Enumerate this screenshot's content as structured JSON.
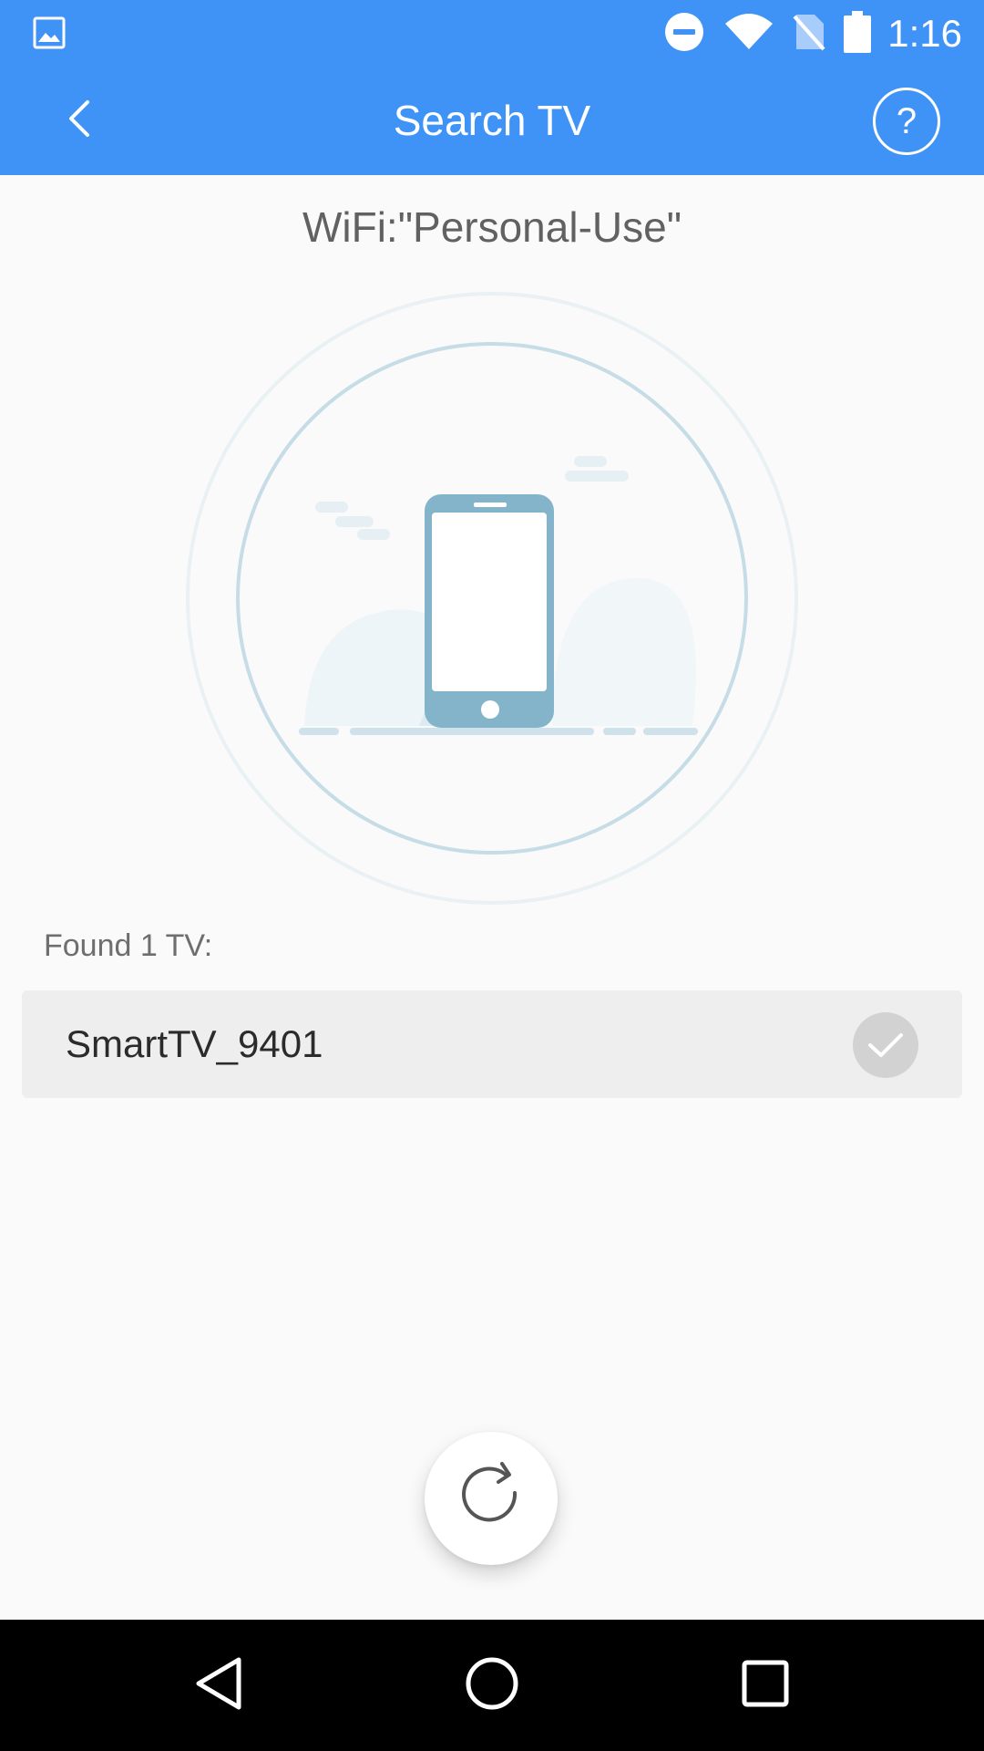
{
  "status_bar": {
    "time": "1:16",
    "icons": [
      "gallery-icon",
      "do-not-disturb-icon",
      "wifi-icon",
      "no-sim-icon",
      "battery-icon"
    ]
  },
  "app_bar": {
    "title": "Search TV",
    "back_icon": "chevron-left-icon",
    "help_label": "?"
  },
  "wifi": {
    "label": "WiFi:\"Personal-Use\""
  },
  "results": {
    "found_label": "Found 1 TV:",
    "devices": [
      {
        "name": "SmartTV_9401",
        "selected_icon": "check-icon"
      }
    ]
  },
  "refresh": {
    "icon": "refresh-icon"
  },
  "nav_bar": {
    "icons": [
      "back-triangle-icon",
      "home-circle-icon",
      "recents-square-icon"
    ]
  },
  "colors": {
    "primary": "#3f93f6",
    "background": "#fafafa",
    "list_item": "#eeeeee",
    "check_circle": "#d2d2d2",
    "illustration_phone": "#84b4c9",
    "illustration_ring": "#c6dce6"
  }
}
